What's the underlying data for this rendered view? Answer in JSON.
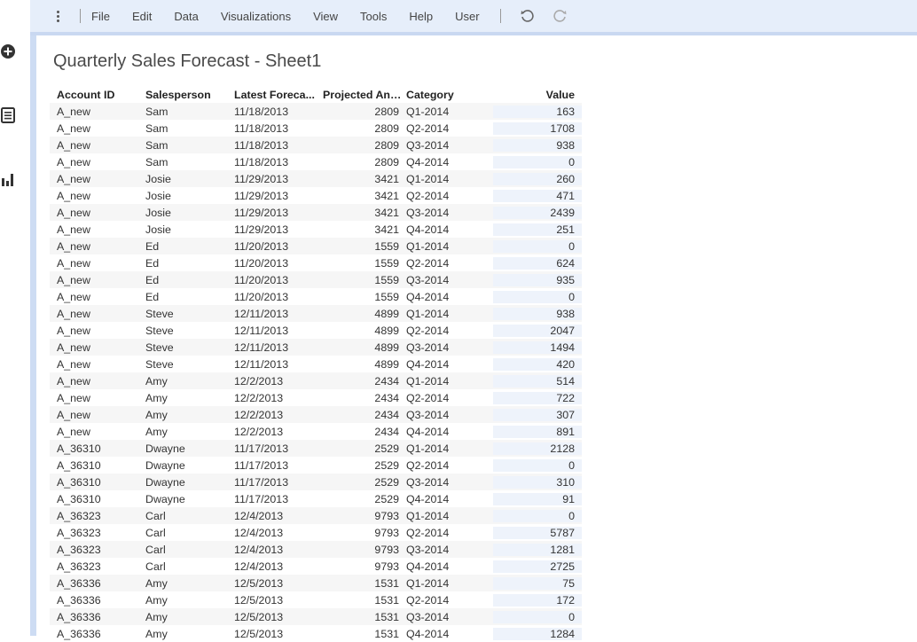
{
  "menubar": {
    "items": [
      "File",
      "Edit",
      "Data",
      "Visualizations",
      "View",
      "Tools",
      "Help",
      "User"
    ]
  },
  "rail_icons": [
    "add-icon",
    "table-icon",
    "bar-chart-icon"
  ],
  "sheet": {
    "title": "Quarterly Sales Forecast - Sheet1"
  },
  "columns": [
    "Account ID",
    "Salesperson",
    "Latest Foreca...",
    "Projected Ann...",
    "Category",
    "Value"
  ],
  "rows": [
    [
      "A_new",
      "Sam",
      "11/18/2013",
      "2809",
      "Q1-2014",
      "163"
    ],
    [
      "A_new",
      "Sam",
      "11/18/2013",
      "2809",
      "Q2-2014",
      "1708"
    ],
    [
      "A_new",
      "Sam",
      "11/18/2013",
      "2809",
      "Q3-2014",
      "938"
    ],
    [
      "A_new",
      "Sam",
      "11/18/2013",
      "2809",
      "Q4-2014",
      "0"
    ],
    [
      "A_new",
      "Josie",
      "11/29/2013",
      "3421",
      "Q1-2014",
      "260"
    ],
    [
      "A_new",
      "Josie",
      "11/29/2013",
      "3421",
      "Q2-2014",
      "471"
    ],
    [
      "A_new",
      "Josie",
      "11/29/2013",
      "3421",
      "Q3-2014",
      "2439"
    ],
    [
      "A_new",
      "Josie",
      "11/29/2013",
      "3421",
      "Q4-2014",
      "251"
    ],
    [
      "A_new",
      "Ed",
      "11/20/2013",
      "1559",
      "Q1-2014",
      "0"
    ],
    [
      "A_new",
      "Ed",
      "11/20/2013",
      "1559",
      "Q2-2014",
      "624"
    ],
    [
      "A_new",
      "Ed",
      "11/20/2013",
      "1559",
      "Q3-2014",
      "935"
    ],
    [
      "A_new",
      "Ed",
      "11/20/2013",
      "1559",
      "Q4-2014",
      "0"
    ],
    [
      "A_new",
      "Steve",
      "12/11/2013",
      "4899",
      "Q1-2014",
      "938"
    ],
    [
      "A_new",
      "Steve",
      "12/11/2013",
      "4899",
      "Q2-2014",
      "2047"
    ],
    [
      "A_new",
      "Steve",
      "12/11/2013",
      "4899",
      "Q3-2014",
      "1494"
    ],
    [
      "A_new",
      "Steve",
      "12/11/2013",
      "4899",
      "Q4-2014",
      "420"
    ],
    [
      "A_new",
      "Amy",
      "12/2/2013",
      "2434",
      "Q1-2014",
      "514"
    ],
    [
      "A_new",
      "Amy",
      "12/2/2013",
      "2434",
      "Q2-2014",
      "722"
    ],
    [
      "A_new",
      "Amy",
      "12/2/2013",
      "2434",
      "Q3-2014",
      "307"
    ],
    [
      "A_new",
      "Amy",
      "12/2/2013",
      "2434",
      "Q4-2014",
      "891"
    ],
    [
      "A_36310",
      "Dwayne",
      "11/17/2013",
      "2529",
      "Q1-2014",
      "2128"
    ],
    [
      "A_36310",
      "Dwayne",
      "11/17/2013",
      "2529",
      "Q2-2014",
      "0"
    ],
    [
      "A_36310",
      "Dwayne",
      "11/17/2013",
      "2529",
      "Q3-2014",
      "310"
    ],
    [
      "A_36310",
      "Dwayne",
      "11/17/2013",
      "2529",
      "Q4-2014",
      "91"
    ],
    [
      "A_36323",
      "Carl",
      "12/4/2013",
      "9793",
      "Q1-2014",
      "0"
    ],
    [
      "A_36323",
      "Carl",
      "12/4/2013",
      "9793",
      "Q2-2014",
      "5787"
    ],
    [
      "A_36323",
      "Carl",
      "12/4/2013",
      "9793",
      "Q3-2014",
      "1281"
    ],
    [
      "A_36323",
      "Carl",
      "12/4/2013",
      "9793",
      "Q4-2014",
      "2725"
    ],
    [
      "A_36336",
      "Amy",
      "12/5/2013",
      "1531",
      "Q1-2014",
      "75"
    ],
    [
      "A_36336",
      "Amy",
      "12/5/2013",
      "1531",
      "Q2-2014",
      "172"
    ],
    [
      "A_36336",
      "Amy",
      "12/5/2013",
      "1531",
      "Q3-2014",
      "0"
    ],
    [
      "A_36336",
      "Amy",
      "12/5/2013",
      "1531",
      "Q4-2014",
      "1284"
    ]
  ]
}
